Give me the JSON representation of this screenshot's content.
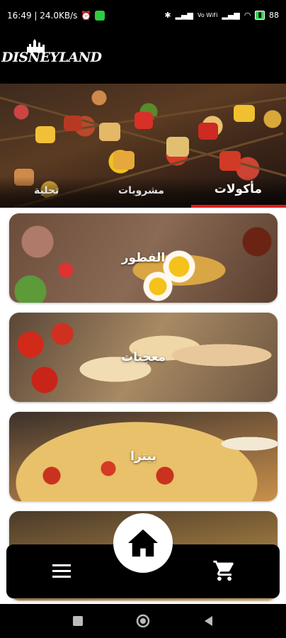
{
  "status_bar": {
    "time_speed": "16:49 | 24.0KB/s",
    "network": "Vo WiFi",
    "battery": "88"
  },
  "header": {
    "logo_text": "DISNEYLAND"
  },
  "tabs": [
    {
      "label": "مأكولات",
      "active": true
    },
    {
      "label": "مشروبات",
      "active": false
    },
    {
      "label": "تحلية",
      "active": false
    }
  ],
  "categories": [
    {
      "label": "الفطور"
    },
    {
      "label": "معجنات"
    },
    {
      "label": "بيتزا"
    },
    {
      "label": ""
    }
  ],
  "bottom_nav": {
    "menu_icon": "hamburger-menu-icon",
    "home_icon": "home-icon",
    "cart_icon": "shopping-cart-icon"
  },
  "colors": {
    "accent": "#e21b1b",
    "bar": "#000000",
    "fab": "#ffffff"
  }
}
